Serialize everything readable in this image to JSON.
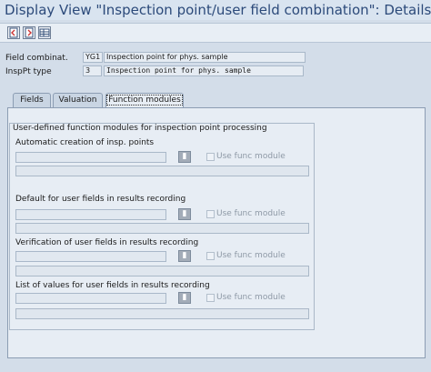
{
  "window": {
    "title": "Display View \"Inspection point/user field combination\": Details"
  },
  "toolbar": {
    "buttons": [
      {
        "icon": "previous-entry-icon"
      },
      {
        "icon": "next-entry-icon"
      },
      {
        "icon": "table-view-icon"
      }
    ]
  },
  "header": {
    "field_combination": {
      "label": "Field combinat.",
      "code": "YG1",
      "description": "Inspection point for phys. sample"
    },
    "insp_pt_type": {
      "label": "InspPt type",
      "code": "3",
      "description": "Inspection point for phys. sample"
    }
  },
  "tabs": [
    {
      "label": "Fields",
      "active": false
    },
    {
      "label": "Valuation",
      "active": false
    },
    {
      "label": "Function modules",
      "active": true
    }
  ],
  "group": {
    "title": "User-defined function modules for inspection point processing",
    "sections": [
      {
        "title": "Automatic creation of insp. points",
        "checkbox_label": "Use func module",
        "checked": false
      },
      {
        "title": "Default for user fields in results recording",
        "checkbox_label": "Use func module",
        "checked": false
      },
      {
        "title": "Verification of user fields in results recording",
        "checkbox_label": "Use func module",
        "checked": false
      },
      {
        "title": "List of values for user fields in results recording",
        "checkbox_label": "Use func module",
        "checked": false
      }
    ]
  }
}
